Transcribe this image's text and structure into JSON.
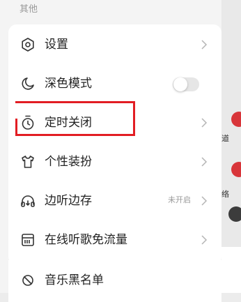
{
  "section_header": "其他",
  "menu": [
    {
      "label": "设置",
      "icon": "hexagon-settings-icon",
      "chevron": true
    },
    {
      "label": "深色模式",
      "icon": "moon-icon",
      "toggle": false
    },
    {
      "label": "定时关闭",
      "icon": "timer-icon",
      "chevron": true
    },
    {
      "label": "个性装扮",
      "icon": "tshirt-icon",
      "chevron": true
    },
    {
      "label": "边听边存",
      "icon": "headphones-icon",
      "status": "未开启",
      "chevron": true
    },
    {
      "label": "在线听歌免流量",
      "icon": "sim-card-icon",
      "chevron": true
    },
    {
      "label": "音乐黑名单",
      "icon": "blocked-icon"
    }
  ],
  "background": {
    "labels": [
      "道",
      "络"
    ],
    "accent_color": "#d8353a"
  },
  "highlight_color": "#e21d23"
}
